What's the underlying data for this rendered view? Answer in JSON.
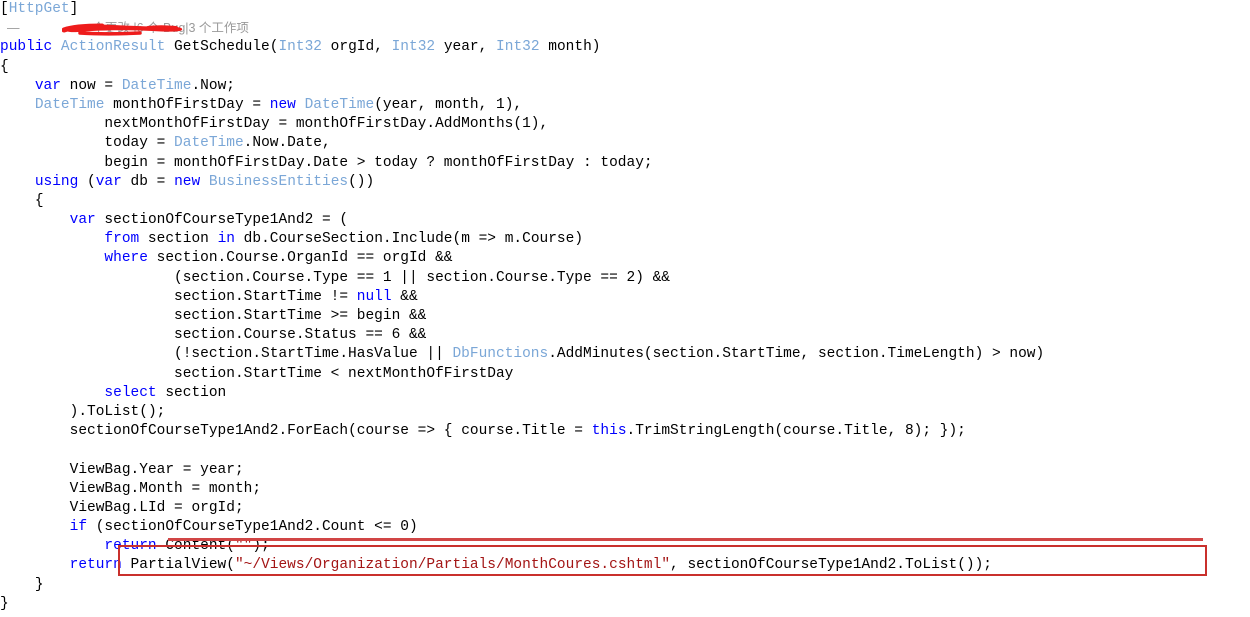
{
  "app": {
    "kind": "code-editor-snippet",
    "language": "C#",
    "background_color": "#ffffff",
    "theme": "light"
  },
  "colors": {
    "keyword": "#0000ff",
    "type": "#7ba7d7",
    "string": "#a31515",
    "plain_text": "#000000",
    "codelens_text": "#9a9a9a",
    "annotation_red": "#c9302c",
    "strikethrough_red": "#d14545",
    "redaction_red": "#ee1c1c"
  },
  "codelens": {
    "dash": "—",
    "redacted_author": "",
    "changes_label": "个更改",
    "bug_count": "6",
    "bug_label": "个 Bug",
    "workitem_count": "3",
    "workitem_label": "个工作项",
    "separator": "|",
    "full_text": "个更改 | 6 个 Bug | 3 个工作项"
  },
  "annotations": {
    "redaction": {
      "name": "red-scribble-over-author",
      "color": "#ee1c1c"
    },
    "strikethrough": {
      "name": "red-strikethrough-over-return-content",
      "target_line_text": "return Content(\"\");",
      "color": "#d14545"
    },
    "callout_box": {
      "name": "red-rectangle-highlight",
      "target_line_text": "return PartialView(\"~/Views/Organization/Partials/MonthCoures.cshtml\", sectionOfCourseType1And2.ToList());",
      "color": "#c9302c"
    }
  },
  "code": {
    "lines": [
      {
        "indent": 0,
        "tokens": [
          {
            "t": "plain",
            "v": "["
          },
          {
            "t": "attr",
            "v": "HttpGet"
          },
          {
            "t": "plain",
            "v": "]"
          }
        ]
      },
      {
        "indent": 0,
        "codelens": true,
        "tokens": []
      },
      {
        "indent": 0,
        "tokens": [
          {
            "t": "kw",
            "v": "public"
          },
          {
            "t": "plain",
            "v": " "
          },
          {
            "t": "type",
            "v": "ActionResult"
          },
          {
            "t": "plain",
            "v": " GetSchedule("
          },
          {
            "t": "type",
            "v": "Int32"
          },
          {
            "t": "plain",
            "v": " orgId, "
          },
          {
            "t": "type",
            "v": "Int32"
          },
          {
            "t": "plain",
            "v": " year, "
          },
          {
            "t": "type",
            "v": "Int32"
          },
          {
            "t": "plain",
            "v": " month)"
          }
        ]
      },
      {
        "indent": 0,
        "tokens": [
          {
            "t": "plain",
            "v": "{"
          }
        ]
      },
      {
        "indent": 1,
        "tokens": [
          {
            "t": "kw",
            "v": "var"
          },
          {
            "t": "plain",
            "v": " now = "
          },
          {
            "t": "type",
            "v": "DateTime"
          },
          {
            "t": "plain",
            "v": ".Now;"
          }
        ]
      },
      {
        "indent": 1,
        "tokens": [
          {
            "t": "type",
            "v": "DateTime"
          },
          {
            "t": "plain",
            "v": " monthOfFirstDay = "
          },
          {
            "t": "kw",
            "v": "new"
          },
          {
            "t": "plain",
            "v": " "
          },
          {
            "t": "type",
            "v": "DateTime"
          },
          {
            "t": "plain",
            "v": "(year, month, 1),"
          }
        ]
      },
      {
        "indent": 3,
        "tokens": [
          {
            "t": "plain",
            "v": "nextMonthOfFirstDay = monthOfFirstDay.AddMonths(1),"
          }
        ]
      },
      {
        "indent": 3,
        "tokens": [
          {
            "t": "plain",
            "v": "today = "
          },
          {
            "t": "type",
            "v": "DateTime"
          },
          {
            "t": "plain",
            "v": ".Now.Date,"
          }
        ]
      },
      {
        "indent": 3,
        "tokens": [
          {
            "t": "plain",
            "v": "begin = monthOfFirstDay.Date > today ? monthOfFirstDay : today;"
          }
        ]
      },
      {
        "indent": 1,
        "tokens": [
          {
            "t": "kw",
            "v": "using"
          },
          {
            "t": "plain",
            "v": " ("
          },
          {
            "t": "kw",
            "v": "var"
          },
          {
            "t": "plain",
            "v": " db = "
          },
          {
            "t": "kw",
            "v": "new"
          },
          {
            "t": "plain",
            "v": " "
          },
          {
            "t": "type",
            "v": "BusinessEntities"
          },
          {
            "t": "plain",
            "v": "())"
          }
        ]
      },
      {
        "indent": 1,
        "tokens": [
          {
            "t": "plain",
            "v": "{"
          }
        ]
      },
      {
        "indent": 2,
        "tokens": [
          {
            "t": "kw",
            "v": "var"
          },
          {
            "t": "plain",
            "v": " sectionOfCourseType1And2 = ("
          }
        ]
      },
      {
        "indent": 3,
        "tokens": [
          {
            "t": "kw",
            "v": "from"
          },
          {
            "t": "plain",
            "v": " section "
          },
          {
            "t": "kw",
            "v": "in"
          },
          {
            "t": "plain",
            "v": " db.CourseSection.Include(m => m.Course)"
          }
        ]
      },
      {
        "indent": 3,
        "tokens": [
          {
            "t": "kw",
            "v": "where"
          },
          {
            "t": "plain",
            "v": " section.Course.OrganId == orgId &&"
          }
        ]
      },
      {
        "indent": 5,
        "tokens": [
          {
            "t": "plain",
            "v": "(section.Course.Type == 1 || section.Course.Type == 2) &&"
          }
        ]
      },
      {
        "indent": 5,
        "tokens": [
          {
            "t": "plain",
            "v": "section.StartTime != "
          },
          {
            "t": "kw",
            "v": "null"
          },
          {
            "t": "plain",
            "v": " &&"
          }
        ]
      },
      {
        "indent": 5,
        "tokens": [
          {
            "t": "plain",
            "v": "section.StartTime >= begin &&"
          }
        ]
      },
      {
        "indent": 5,
        "tokens": [
          {
            "t": "plain",
            "v": "section.Course.Status == 6 &&"
          }
        ]
      },
      {
        "indent": 5,
        "tokens": [
          {
            "t": "plain",
            "v": "(!section.StartTime.HasValue || "
          },
          {
            "t": "type",
            "v": "DbFunctions"
          },
          {
            "t": "plain",
            "v": ".AddMinutes(section.StartTime, section.TimeLength) > now)"
          }
        ]
      },
      {
        "indent": 5,
        "tokens": [
          {
            "t": "plain",
            "v": "section.StartTime < nextMonthOfFirstDay"
          }
        ]
      },
      {
        "indent": 3,
        "tokens": [
          {
            "t": "kw",
            "v": "select"
          },
          {
            "t": "plain",
            "v": " section"
          }
        ]
      },
      {
        "indent": 2,
        "tokens": [
          {
            "t": "plain",
            "v": ").ToList();"
          }
        ]
      },
      {
        "indent": 2,
        "tokens": [
          {
            "t": "plain",
            "v": "sectionOfCourseType1And2.ForEach(course => { course.Title = "
          },
          {
            "t": "kw",
            "v": "this"
          },
          {
            "t": "plain",
            "v": ".TrimStringLength(course.Title, 8); });"
          }
        ]
      },
      {
        "indent": 0,
        "tokens": []
      },
      {
        "indent": 2,
        "tokens": [
          {
            "t": "plain",
            "v": "ViewBag.Year = year;"
          }
        ]
      },
      {
        "indent": 2,
        "tokens": [
          {
            "t": "plain",
            "v": "ViewBag.Month = month;"
          }
        ]
      },
      {
        "indent": 2,
        "tokens": [
          {
            "t": "plain",
            "v": "ViewBag.LId = orgId;"
          }
        ]
      },
      {
        "indent": 2,
        "tokens": [
          {
            "t": "kw",
            "v": "if"
          },
          {
            "t": "plain",
            "v": " (sectionOfCourseType1And2.Count <= 0)"
          }
        ]
      },
      {
        "indent": 3,
        "struck": true,
        "tokens": [
          {
            "t": "kw",
            "v": "return"
          },
          {
            "t": "plain",
            "v": " Content("
          },
          {
            "t": "str",
            "v": "\"\""
          },
          {
            "t": "plain",
            "v": ");"
          }
        ]
      },
      {
        "indent": 2,
        "boxed": true,
        "tokens": [
          {
            "t": "kw",
            "v": "return"
          },
          {
            "t": "plain",
            "v": " PartialView("
          },
          {
            "t": "str",
            "v": "\"~/Views/Organization/Partials/MonthCoures.cshtml\""
          },
          {
            "t": "plain",
            "v": ", sectionOfCourseType1And2.ToList());"
          }
        ]
      },
      {
        "indent": 1,
        "tokens": [
          {
            "t": "plain",
            "v": "}"
          }
        ]
      },
      {
        "indent": 0,
        "tokens": [
          {
            "t": "plain",
            "v": "}"
          }
        ]
      }
    ]
  }
}
